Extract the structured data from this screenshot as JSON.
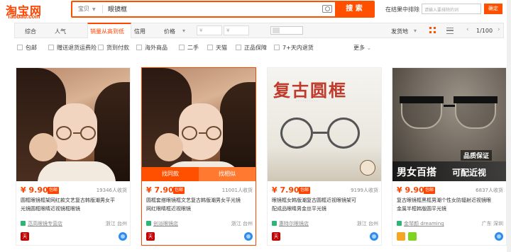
{
  "header": {
    "logo_cn": "淘宝网",
    "logo_en": "Taobao.com",
    "search_scope": "宝贝",
    "search_query": "眼镜框",
    "search_button": "搜 索",
    "exclude_label": "在结果中排除",
    "exclude_placeholder": "请输入要排除的词",
    "exclude_button": "确定"
  },
  "sort": {
    "items": [
      "综合",
      "人气",
      "销量从高到低",
      "信用",
      "价格"
    ],
    "price_min": "¥",
    "price_max": "¥",
    "dash": "-",
    "ship_from": "发货地",
    "page": "1/100"
  },
  "filters": [
    "包邮",
    "赠送退货运费险",
    "货到付款",
    "海外商品",
    "二手",
    "天猫",
    "正品保障",
    "7+天内退货",
    "更多"
  ],
  "products": [
    {
      "price": "¥ 9.90",
      "badge": "包邮",
      "sales": "19346人收货",
      "title1": "圆框眼镜框架网红款文艺复古韩版潮男女平",
      "title2": "光镜圆框眼睛近视镜框眼镜",
      "shop": "范高眼镜专营店",
      "loc": "浙江 台州"
    },
    {
      "price": "¥ 7.90",
      "badge": "包邮",
      "sales": "11001人收货",
      "title1": "圆框套搭眼镜框文艺复古韩版潮男女平光镜",
      "title2": "网红眼睛框近视眼镜",
      "shop": "创派眼镜店",
      "loc": "浙江 台州",
      "overlay_left": "找同款",
      "overlay_right": "找相似"
    },
    {
      "price": "¥ 7.90",
      "badge": "包邮",
      "sales": "9199人收货",
      "title1": "眼镜框女韩版潮复古圆框近视眼镜架可",
      "title2": "配成品眼睛男金丝平光镜",
      "shop": "惠特尔眼镜店",
      "loc": "浙江 台州",
      "art_title": "复古圆框"
    },
    {
      "price": "¥ 9.90",
      "badge": "包邮",
      "sales": "6837人收货",
      "title1": "复古眼镜框黑框男潮个性女防辐射近视镜眼",
      "title2": "金属半框韩版圆平光镜",
      "shop": "金琴颜 dreaming",
      "loc": "广东 深圳",
      "art_quality": "品质保证",
      "art_banner_left": "男女百搭",
      "art_banner_right": "可配近视"
    }
  ]
}
